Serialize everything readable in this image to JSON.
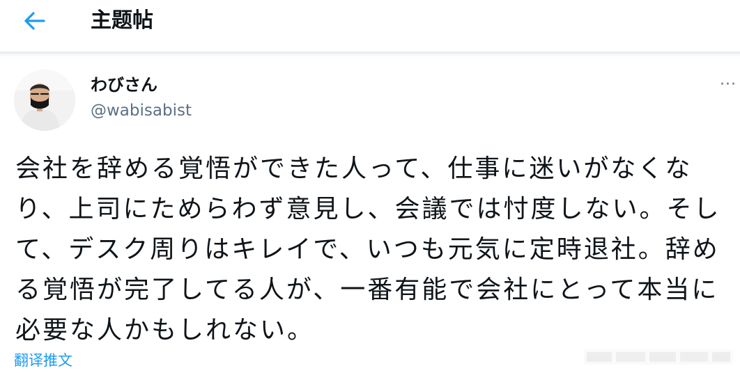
{
  "header": {
    "title": "主题帖",
    "back_icon": "arrow-left-icon"
  },
  "tweet": {
    "author": {
      "display_name": "わびさん",
      "handle": "@wabisabist",
      "avatar_icon": "avatar-photo"
    },
    "more_icon": "more-horizontal-icon",
    "more_label": "···",
    "text": "会社を辞める覚悟ができた人って、仕事に迷いがなくなり、上司にためらわず意見し、会議では忖度しない。そして、デスク周りはキレイで、いつも元気に定時退社。辞める覚悟が完了してる人が、一番有能で会社にとって本当に必要な人かもしれない。",
    "translate_label": "翻译推文"
  },
  "colors": {
    "accent": "#1d9bf0",
    "text_primary": "#0f1419",
    "text_secondary": "#5b7083",
    "divider": "#e6ecf0"
  }
}
